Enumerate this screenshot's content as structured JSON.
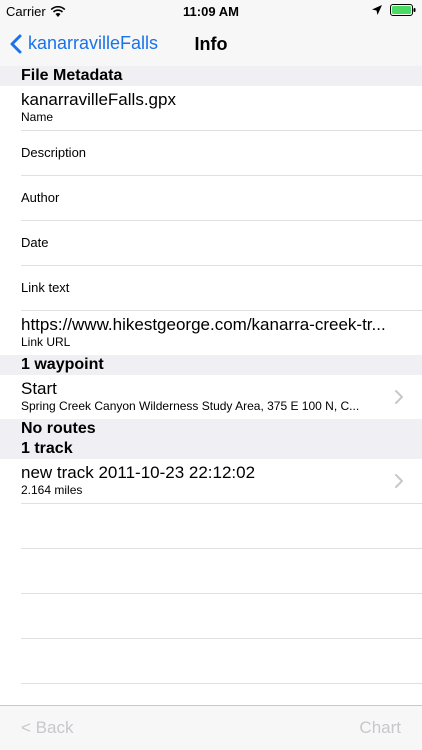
{
  "status_bar": {
    "carrier": "Carrier",
    "time": "11:09 AM"
  },
  "nav": {
    "back_label": "kanarravilleFalls",
    "title": "Info"
  },
  "file_metadata": {
    "header": "File Metadata",
    "rows": [
      {
        "value": "kanarravilleFalls.gpx",
        "label": "Name"
      },
      {
        "value": "",
        "label": "Description"
      },
      {
        "value": "",
        "label": "Author"
      },
      {
        "value": "",
        "label": "Date"
      },
      {
        "value": "",
        "label": "Link text"
      },
      {
        "value": "https://www.hikestgeorge.com/kanarra-creek-tr...",
        "label": "Link URL"
      }
    ]
  },
  "waypoints": {
    "header": "1 waypoint",
    "items": [
      {
        "title": "Start",
        "subtitle": "Spring Creek Canyon Wilderness Study Area, 375 E 100 N, C..."
      }
    ]
  },
  "routes": {
    "header": "No routes"
  },
  "tracks": {
    "header": "1 track",
    "items": [
      {
        "title": "new track 2011-10-23 22:12:02",
        "subtitle": "2.164 miles"
      }
    ]
  },
  "toolbar": {
    "back_label": "< Back",
    "chart_label": "Chart"
  },
  "colors": {
    "accent": "#1a73e8",
    "disabled": "#c7c7cc",
    "section_bg": "#efeff4"
  }
}
